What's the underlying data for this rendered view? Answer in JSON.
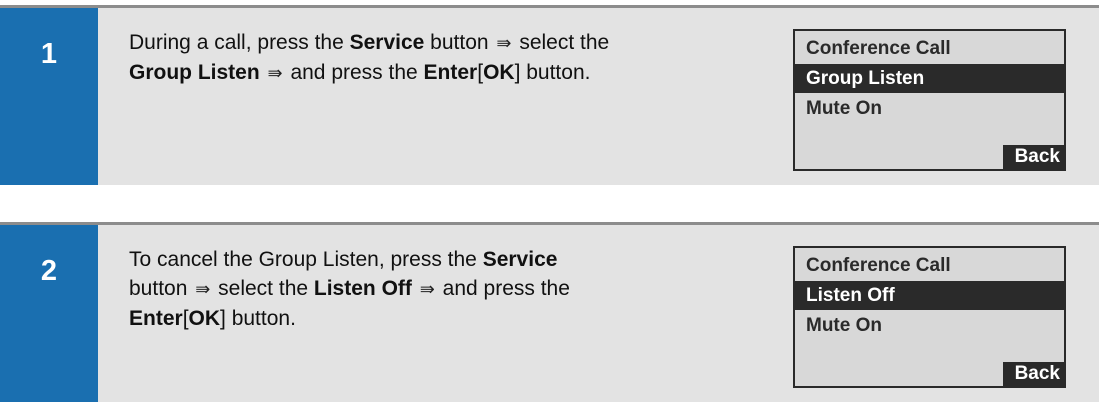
{
  "steps": [
    {
      "number": "1",
      "text": [
        {
          "t": "During a call, press the ",
          "b": false
        },
        {
          "t": "Service",
          "b": true
        },
        {
          "t": " button ",
          "b": false
        },
        {
          "t": "⇛",
          "arrow": true
        },
        {
          "t": " select the ",
          "b": false
        },
        {
          "br": true
        },
        {
          "t": "Group Listen",
          "b": true
        },
        {
          "t": " ",
          "b": false
        },
        {
          "t": "⇛",
          "arrow": true
        },
        {
          "t": " and press the ",
          "b": false
        },
        {
          "t": "Enter",
          "b": true
        },
        {
          "t": "[",
          "b": false
        },
        {
          "t": "OK",
          "b": true
        },
        {
          "t": "] button.",
          "b": false
        }
      ],
      "screen": {
        "items": [
          "Conference Call",
          "Group Listen",
          "Mute On"
        ],
        "selected_index": 1,
        "back_label": "Back"
      }
    },
    {
      "number": "2",
      "text": [
        {
          "t": "To cancel the Group Listen, press the ",
          "b": false
        },
        {
          "t": "Service",
          "b": true
        },
        {
          "br": true
        },
        {
          "t": "button ",
          "b": false
        },
        {
          "t": "⇛",
          "arrow": true
        },
        {
          "t": " select the ",
          "b": false
        },
        {
          "t": "Listen Off",
          "b": true
        },
        {
          "t": " ",
          "b": false
        },
        {
          "t": "⇛",
          "arrow": true
        },
        {
          "t": " and press the ",
          "b": false
        },
        {
          "br": true
        },
        {
          "t": "Enter",
          "b": true
        },
        {
          "t": "[",
          "b": false
        },
        {
          "t": "OK",
          "b": true
        },
        {
          "t": "] button.",
          "b": false
        }
      ],
      "screen": {
        "items": [
          "Conference Call",
          "Listen Off",
          "Mute On"
        ],
        "selected_index": 1,
        "back_label": "Back"
      }
    }
  ],
  "colors": {
    "number_block": "#1a6fb0",
    "panel_background": "#e3e3e3",
    "lcd_background": "#d8d8d8",
    "lcd_dark": "#2a2a2a"
  }
}
